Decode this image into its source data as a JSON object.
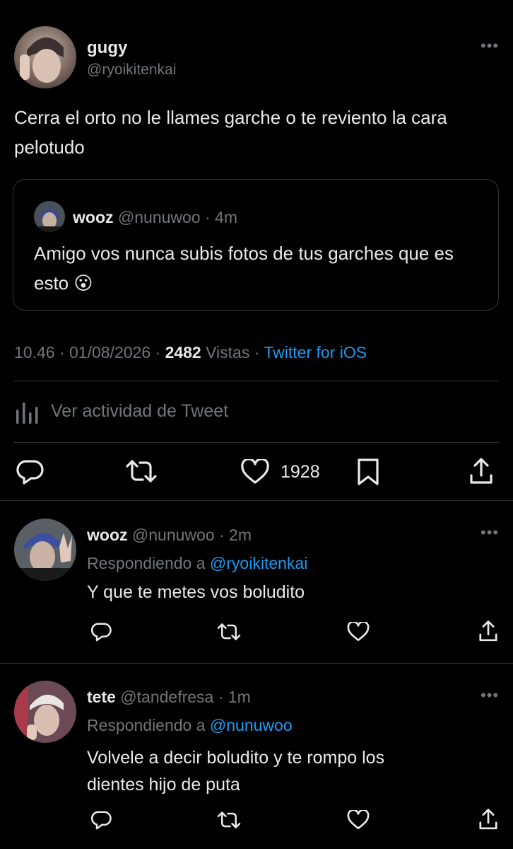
{
  "main_tweet": {
    "author": {
      "name": "gugy",
      "handle": "@ryoikitenkai"
    },
    "text": "Cerra el orto no le llames garche o te reviento la cara pelotudo",
    "quoted": {
      "name": "wooz",
      "handle": "@nunuwoo",
      "time": "· 4m",
      "text": "Amigo vos nunca subis fotos de tus garches que es esto",
      "emoji": "😮"
    },
    "meta": {
      "time": "10.46",
      "date": "· 01/08/2026 ·",
      "views_count": "2482",
      "views_label": "Vistas",
      "sep": "·",
      "source": "Twitter for iOS"
    },
    "activity_label": "Ver actividad de Tweet",
    "like_count": "1928"
  },
  "replies": [
    {
      "name": "wooz",
      "handle": "@nunuwoo · 2m",
      "replying_prefix": "Respondiendo a",
      "replying_to": "@ryoikitenkai",
      "text": "Y que te metes vos boludito"
    },
    {
      "name": "tete",
      "handle": "@tandefresa · 1m",
      "replying_prefix": "Respondiendo a",
      "replying_to": "@nunuwoo",
      "text_lines": [
        "Volvele a decir boludito y te rompo los",
        "dientes hijo de puta"
      ]
    }
  ],
  "colors": {
    "background": "#000000",
    "text": "#e7e9ea",
    "muted": "#71767b",
    "link": "#1d9bf0",
    "border": "#2f3336"
  },
  "icons": [
    "more-icon",
    "reply-icon",
    "retweet-icon",
    "like-icon",
    "bookmark-icon",
    "share-icon",
    "analytics-icon"
  ]
}
